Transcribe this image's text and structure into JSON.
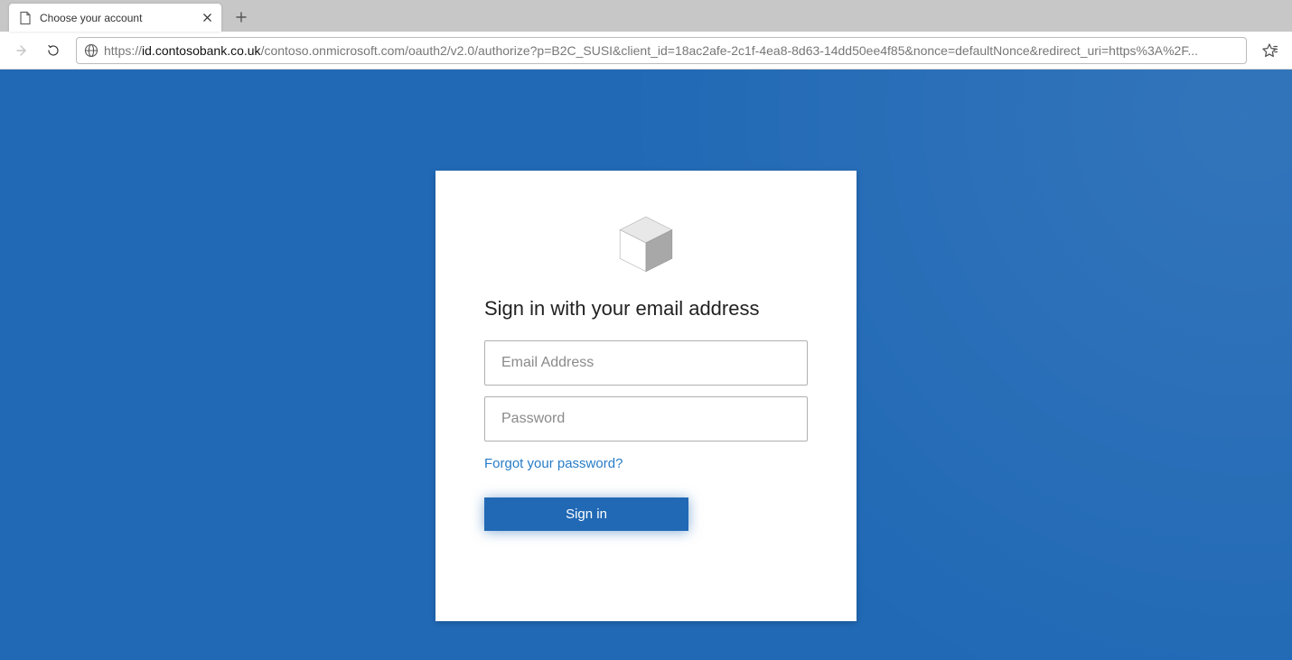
{
  "browser": {
    "tab_title": "Choose your account",
    "url_protocol": "https://",
    "url_host": "id.contosobank.co.uk",
    "url_rest": "/contoso.onmicrosoft.com/oauth2/v2.0/authorize?p=B2C_SUSI&client_id=18ac2afe-2c1f-4ea8-8d63-14dd50ee4f85&nonce=defaultNonce&redirect_uri=https%3A%2F..."
  },
  "signin": {
    "heading": "Sign in with your email address",
    "email_placeholder": "Email Address",
    "password_placeholder": "Password",
    "forgot_label": "Forgot your password?",
    "submit_label": "Sign in"
  }
}
